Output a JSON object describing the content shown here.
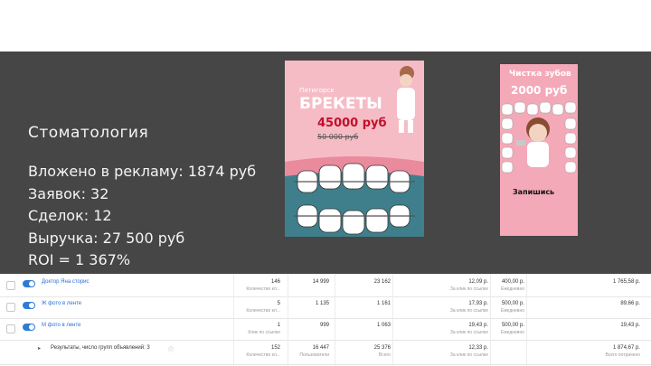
{
  "slide": {
    "heading": "Стоматология",
    "stats": [
      "Вложено в рекламу: 1874 руб",
      "Заявок: 32",
      "Сделок: 12",
      "Выручка: 27 500 руб",
      "ROI = 1 367%"
    ],
    "ad1": {
      "line1": "Пятигорск",
      "line2": "БРЕКЕТЫ",
      "price": "45000 руб",
      "old_price": "50 000 руб"
    },
    "ad2": {
      "line1": "Чистка зубов",
      "price": "2000 руб",
      "cta": "Запишись"
    }
  },
  "table": {
    "rows": [
      {
        "name": "Доктор Яна сторис",
        "c1": "146",
        "c1s": "Количество кл...",
        "c2": "14 999",
        "c3": "23 162",
        "c4": "12,09 р.",
        "c4s": "За клик по ссылке",
        "c5": "400,00 р.",
        "c5s": "Ежедневно",
        "c6": "1 765,58 р."
      },
      {
        "name": "Ж фото в ленте",
        "c1": "5",
        "c1s": "Количество кл...",
        "c2": "1 135",
        "c3": "1 161",
        "c4": "17,93 р.",
        "c4s": "За клик по ссылке",
        "c5": "500,00 р.",
        "c5s": "Ежедневно",
        "c6": "89,66 р."
      },
      {
        "name": "М фото в ленте",
        "c1": "1",
        "c1s": "Клик по ссылке",
        "c2": "999",
        "c3": "1 063",
        "c4": "19,43 р.",
        "c4s": "За клик по ссылке",
        "c5": "500,00 р.",
        "c5s": "Ежедневно",
        "c6": "19,43 р."
      }
    ],
    "summary": {
      "label": "Результаты, число групп объявлений: 3",
      "c1": "152",
      "c1s": "Количество кл...",
      "c2": "16 447",
      "c2s": "Пользователи",
      "c3": "25 376",
      "c3s": "Всего",
      "c4": "12,33 р.",
      "c4s": "За клик по ссылке",
      "c6": "1 874,67 р.",
      "c6s": "Всего потрачено"
    }
  }
}
